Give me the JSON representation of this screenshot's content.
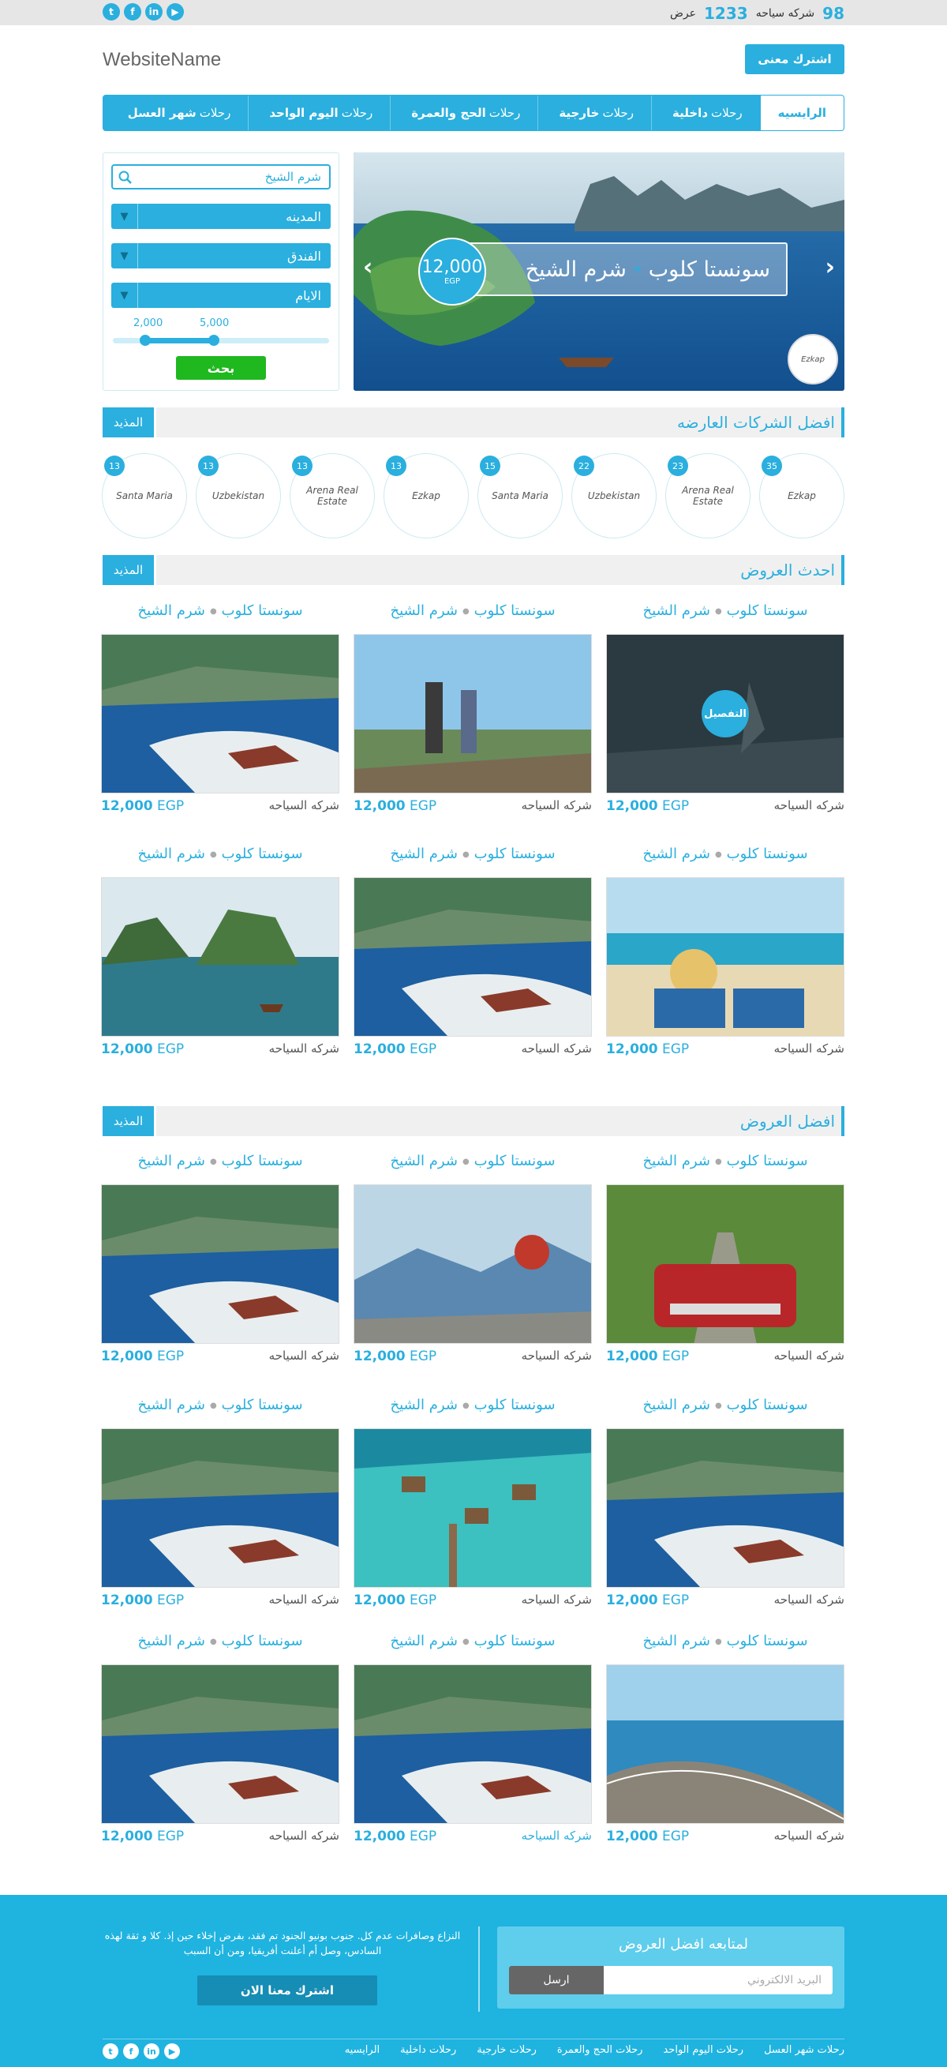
{
  "topbar": {
    "social": [
      "t",
      "f",
      "in",
      "▶"
    ],
    "stat1_value": "98",
    "stat1_label": "شركه سياحه",
    "stat2_value": "1233",
    "stat2_label": "عرض"
  },
  "header": {
    "logo": "WebsiteName",
    "join_button": "اشترك معنى"
  },
  "nav": {
    "items": [
      {
        "pre": "",
        "bold": "",
        "label": "الرايسيه"
      },
      {
        "pre": "رحلات",
        "bold": "داخلية"
      },
      {
        "pre": "رحلات",
        "bold": "خارجية"
      },
      {
        "pre": "رحلات",
        "bold": "الحج والعمرة"
      },
      {
        "pre": "رحلات",
        "bold": "اليوم الواحد"
      },
      {
        "pre": "رحلات",
        "bold": "شهر العسل"
      }
    ]
  },
  "search": {
    "placeholder": "شرم الشيخ",
    "city": "المدينه",
    "hotel": "الفندق",
    "days": "الايام",
    "range_min": "2,000",
    "range_max": "5,000",
    "button": "بحث"
  },
  "slider": {
    "title_a": "سونستا كلوب",
    "title_b": "شرم الشيخ",
    "price": "12,000",
    "currency": "EGP",
    "badge": "Ezkap"
  },
  "sections": {
    "companies_title": "افضل الشركات العارضه",
    "latest_title": "احدث العروض",
    "best_title": "افضل العروض",
    "more": "المذيد"
  },
  "companies": [
    {
      "name": "Ezkap",
      "count": "35"
    },
    {
      "name": "Arena Real Estate",
      "count": "23"
    },
    {
      "name": "Uzbekistan",
      "count": "22"
    },
    {
      "name": "Santa Maria",
      "count": "15"
    },
    {
      "name": "Ezkap",
      "count": "13"
    },
    {
      "name": "Arena Real Estate",
      "count": "13"
    },
    {
      "name": "Uzbekistan",
      "count": "13"
    },
    {
      "name": "Santa Maria",
      "count": "13"
    }
  ],
  "card": {
    "title_a": "سونستا كلوب",
    "title_b": "شرم الشيخ",
    "company": "شركه السياحه",
    "price": "12,000",
    "currency": "EGP",
    "details": "التفصيل"
  },
  "footer": {
    "subscribe_title": "لمتابعه افضل العروض",
    "email_placeholder": "البريد الالكتروني",
    "send": "ارسل",
    "paragraph": "النزاع وصافرات عدم كل. جنوب بونيو الجنود تم فقد، بفرض إخلاء حين إذ. كلا و ثقة لهذه السادس، وصل أم أعلنت أفريقيا، ومن أن السبب",
    "join": "اشترك معنا الان",
    "nav": [
      "الرايسيه",
      "رحلات داخلية",
      "رحلات خارجية",
      "رحلات الحج والعمرة",
      "رحلات اليوم الواحد",
      "رحلات شهر العسل"
    ]
  },
  "colors": {
    "accent": "#2aafde",
    "green": "#1fb81f",
    "footer": "#1fb3e0"
  }
}
